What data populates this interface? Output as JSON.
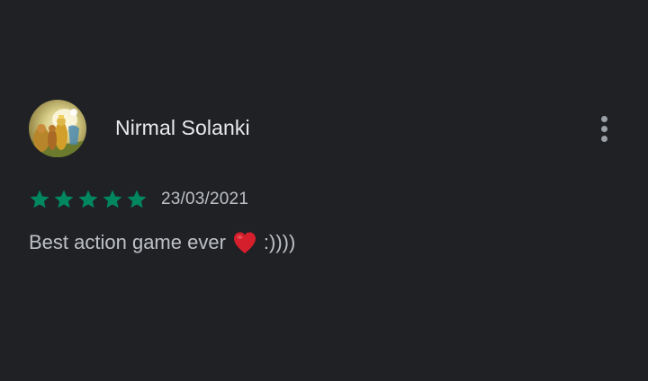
{
  "review": {
    "reviewer_name": "Nirmal Solanki",
    "avatar_icon": "reviewer-avatar-image",
    "more_icon": "more-vert-icon",
    "rating": 5,
    "rating_max": 5,
    "date": "23/03/2021",
    "text_before_emoji": "Best action game ever",
    "emoji": "heart-emoji",
    "text_after_emoji": ":))))"
  },
  "colors": {
    "background": "#202124",
    "name_text": "#e8eaed",
    "body_text": "#bdc1c6",
    "star_fill": "#01875f",
    "menu_dots": "#9aa0a6",
    "heart": "#d61f2c"
  }
}
